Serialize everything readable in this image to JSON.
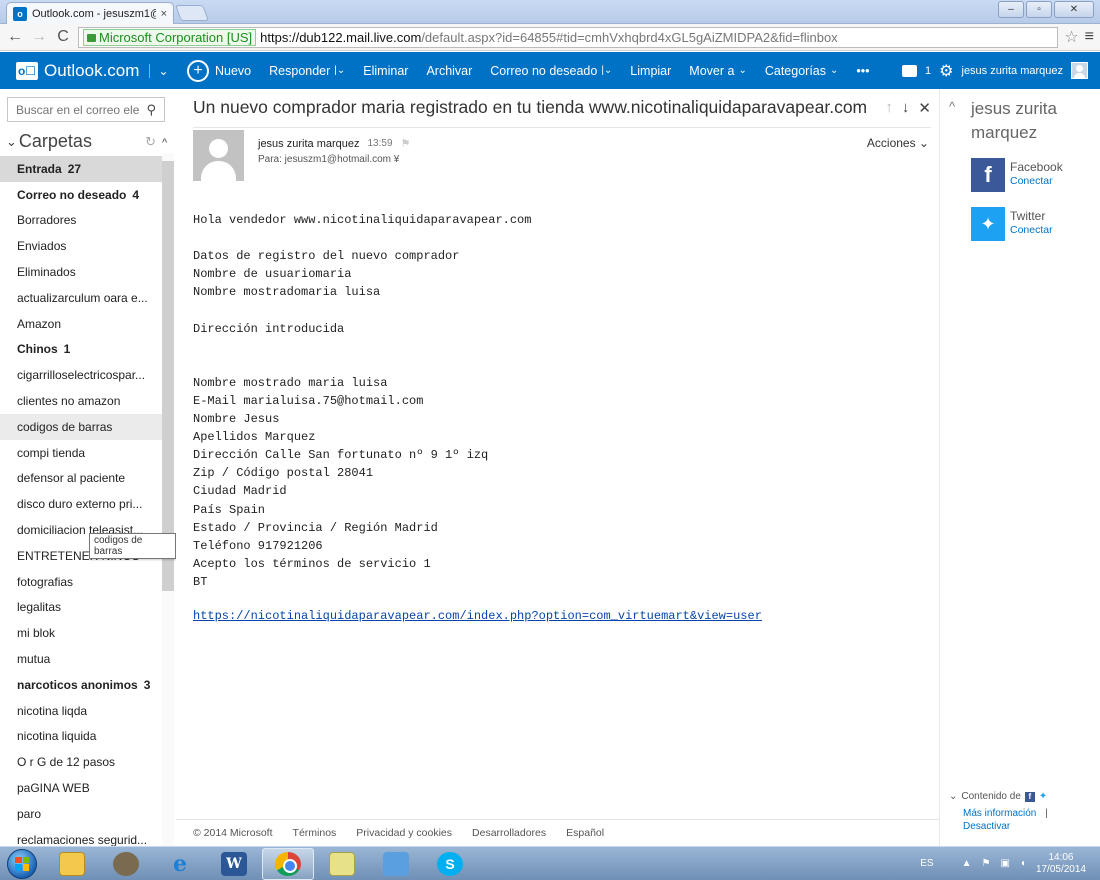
{
  "browser": {
    "tab_title": "Outlook.com - jesuszm1@",
    "tab_close": "×",
    "url_ev": "Microsoft Corporation [US]",
    "url_host": "https://dub122.mail.live.com",
    "url_rest": "/default.aspx?id=64855#tid=cmhVxhqbrd4xGL5gAiZMIDPA2&fid=flinbox",
    "back": "←",
    "forward": "→",
    "reload": "C",
    "star": "☆",
    "menu": "≡",
    "win_min": "‒",
    "win_max": "▫",
    "win_close": "✕"
  },
  "header": {
    "brand": "Outlook.com",
    "brand_chevron": "⌄",
    "commands": [
      {
        "label": "Nuevo",
        "icon": "plus-circle-icon"
      },
      {
        "label": "Responder",
        "dropdown": "⌄"
      },
      {
        "label": "Eliminar"
      },
      {
        "label": "Archivar"
      },
      {
        "label": "Correo no deseado",
        "dropdown": "⌄"
      },
      {
        "label": "Limpiar"
      },
      {
        "label": "Mover a",
        "dropdown": "⌄"
      },
      {
        "label": "Categorías",
        "dropdown": "⌄"
      },
      {
        "label": "•••"
      }
    ],
    "messages_count": "1",
    "user_name": "jesus zurita marquez"
  },
  "left": {
    "search_placeholder": "Buscar en el correo ele",
    "folders_title": "Carpetas",
    "folders": [
      {
        "label": "Entrada",
        "count": "27",
        "bold": true,
        "selected": true
      },
      {
        "label": "Correo no deseado",
        "count": "4",
        "bold": true
      },
      {
        "label": "Borradores"
      },
      {
        "label": "Enviados"
      },
      {
        "label": "Eliminados"
      },
      {
        "label": "actualizarculum oara e..."
      },
      {
        "label": "Amazon"
      },
      {
        "label": "Chinos",
        "count": "1",
        "bold": true
      },
      {
        "label": "cigarrilloselectricospar..."
      },
      {
        "label": "clientes no amazon"
      },
      {
        "label": "codigos de barras",
        "hover": true
      },
      {
        "label": "compi tienda"
      },
      {
        "label": "defensor al paciente"
      },
      {
        "label": "disco duro externo pri..."
      },
      {
        "label": "domiciliacion teleasist..."
      },
      {
        "label": "ENTRETENER NIÑOS"
      },
      {
        "label": "fotografias"
      },
      {
        "label": "legalitas"
      },
      {
        "label": "mi blok"
      },
      {
        "label": "mutua"
      },
      {
        "label": "narcoticos anonimos",
        "count": "3",
        "bold": true
      },
      {
        "label": "nicotina liqda"
      },
      {
        "label": "nicotina liquida"
      },
      {
        "label": "O r G de 12 pasos"
      },
      {
        "label": "paGINA WEB"
      },
      {
        "label": "paro"
      },
      {
        "label": "reclamaciones segurid..."
      }
    ],
    "tooltip": "codigos de barras"
  },
  "message": {
    "subject": "Un nuevo comprador maria registrado en tu tienda www.nicotinaliquidaparavapear.com",
    "sender": "jesus zurita marquez",
    "time": "13:59",
    "to": "Para: jesuszm1@hotmail.com",
    "to_chevron": "¥",
    "actions": "Acciones ⌄",
    "body_lines": [
      "Hola vendedor www.nicotinaliquidaparavapear.com",
      "",
      "Datos de registro del nuevo comprador",
      "Nombre de usuariomaria",
      "Nombre mostradomaria luisa",
      "",
      "Dirección introducida",
      "",
      "",
      "Nombre mostrado maria luisa",
      "E-Mail marialuisa.75@hotmail.com",
      "Nombre Jesus",
      "Apellidos Marquez",
      "Dirección Calle San fortunato nº 9 1º izq",
      "Zip / Código postal 28041",
      "Ciudad Madrid",
      "País Spain",
      "Estado / Provincia / Región Madrid",
      "Teléfono 917921206",
      "Acepto los términos de servicio 1",
      "BT"
    ],
    "link": "https://nicotinaliquidaparavapear.com/index.php?option=com_virtuemart&view=user"
  },
  "footer": {
    "copyright": "© 2014 Microsoft",
    "links": [
      "Términos",
      "Privacidad y cookies",
      "Desarrolladores",
      "Español"
    ]
  },
  "right": {
    "name": "jesus zurita marquez",
    "facebook": "Facebook",
    "twitter": "Twitter",
    "connect": "Conectar",
    "content_from": "Contenido de",
    "more_info": "Más información",
    "separator": "|",
    "disable": "Desactivar"
  },
  "taskbar": {
    "lang": "ES",
    "time": "14:06",
    "date": "17/05/2014"
  }
}
